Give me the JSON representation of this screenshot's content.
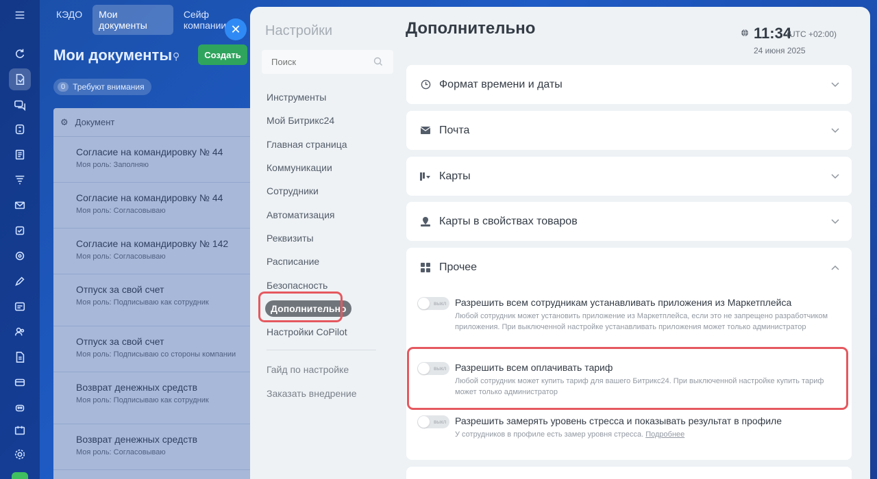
{
  "rail": {
    "icons": [
      "refresh-icon",
      "document-sign-icon",
      "chat-icon",
      "sites-icon",
      "tasks-icon",
      "filter-icon",
      "mail-icon",
      "checklist-icon",
      "target-icon",
      "pen-icon",
      "calendar-card-icon",
      "team-icon",
      "file-icon",
      "card-icon",
      "robot-icon",
      "calendar-icon",
      "gear-icon"
    ]
  },
  "bg_app": {
    "tabs": [
      "КЭДО",
      "Мои документы",
      "Сейф компании"
    ],
    "active_tab": 1,
    "title": "Мои документы",
    "create_label": "Создать",
    "attention_count": "0",
    "attention_label": "Требуют внимания",
    "list_header": "Документ",
    "rows": [
      {
        "title": "Согласие на командировку № 44",
        "role": "Моя роль: Заполняю"
      },
      {
        "title": "Согласие на командировку № 44",
        "role": "Моя роль: Согласовываю"
      },
      {
        "title": "Согласие на командировку № 142",
        "role": "Моя роль: Согласовываю"
      },
      {
        "title": "Отпуск за свой счет",
        "role": "Моя роль: Подписываю как сотрудник"
      },
      {
        "title": "Отпуск за свой счет",
        "role": "Моя роль: Подписываю со стороны компании"
      },
      {
        "title": "Возврат денежных средств",
        "role": "Моя роль: Подписываю как сотрудник"
      },
      {
        "title": "Возврат денежных средств",
        "role": "Моя роль: Согласовываю"
      }
    ]
  },
  "close_label": "✕",
  "settings": {
    "title": "Настройки",
    "search_placeholder": "Поиск",
    "menu": [
      "Инструменты",
      "Мой Битрикс24",
      "Главная страница",
      "Коммуникации",
      "Сотрудники",
      "Автоматизация",
      "Реквизиты",
      "Расписание",
      "Безопасность",
      "Дополнительно",
      "Настройки CoPilot"
    ],
    "active_index": 9,
    "menu_secondary": [
      "Гайд по настройке",
      "Заказать внедрение"
    ]
  },
  "content": {
    "title": "Дополнительно",
    "time": "11:34",
    "timezone": "(UTC +02:00)",
    "date": "24 июня 2025",
    "sections": [
      {
        "label": "Формат времени и даты",
        "icon": "clock-icon",
        "expanded": false
      },
      {
        "label": "Почта",
        "icon": "envelope-icon",
        "expanded": false
      },
      {
        "label": "Карты",
        "icon": "map-filter-icon",
        "expanded": false
      },
      {
        "label": "Карты в свойствах товаров",
        "icon": "location-pin-icon",
        "expanded": false
      },
      {
        "label": "Прочее",
        "icon": "grid-icon",
        "expanded": true
      }
    ],
    "options": [
      {
        "toggle_label": "выкл",
        "title": "Разрешить всем сотрудникам устанавливать приложения из Маркетплейса",
        "desc": "Любой сотрудник может установить приложение из Маркетплейса, если это не запрещено разработчиком приложения. При выключенной настройке устанавливать приложения может только администратор",
        "enabled": false
      },
      {
        "toggle_label": "выкл",
        "title": "Разрешить всем оплачивать тариф",
        "desc": "Любой сотрудник может купить тариф для вашего Битрикс24. При выключенной настройке купить тариф может только администратор",
        "enabled": false
      },
      {
        "toggle_label": "выкл",
        "title": "Разрешить замерять уровень стресса и показывать результат в профиле",
        "desc": "У сотрудников в профиле есть замер уровня стресса.",
        "link": "Подробнее",
        "enabled": false
      }
    ]
  },
  "colors": {
    "highlight": "#e5585f",
    "create_button": "#2fa45d",
    "close_button": "#2f8af5",
    "active_pill": "#6f757b"
  }
}
